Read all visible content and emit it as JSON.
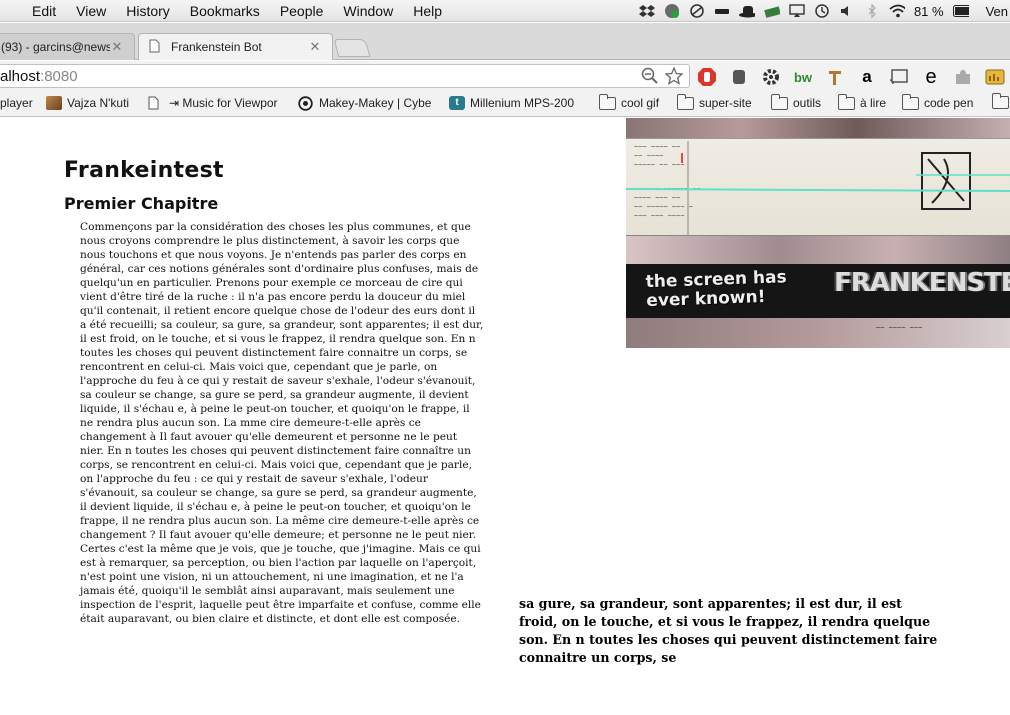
{
  "menubar": {
    "app_items": [
      "Edit",
      "View",
      "History",
      "Bookmarks",
      "People",
      "Window",
      "Help"
    ],
    "battery_percent": "81 %",
    "clock": "Ven"
  },
  "tabs": [
    {
      "title": "(93) - garcins@news",
      "active": false
    },
    {
      "title": "Frankenstein Bot",
      "active": true
    }
  ],
  "address_bar": {
    "host": "alhost",
    "port": ":8080"
  },
  "bookmarks": [
    {
      "label": "player",
      "icon": "none"
    },
    {
      "label": "Vajza N'kuti",
      "icon": "thumbnail-icon"
    },
    {
      "label": "⇥ Music for Viewpor",
      "icon": "page-icon"
    },
    {
      "label": "Makey-Makey | Cybe",
      "icon": "circle-logo-icon"
    },
    {
      "label": "Millenium MPS-200",
      "icon": "tumblr-icon"
    },
    {
      "label": "cool gif",
      "icon": "folder-icon"
    },
    {
      "label": "super-site",
      "icon": "folder-icon"
    },
    {
      "label": "outils",
      "icon": "folder-icon"
    },
    {
      "label": "à lire",
      "icon": "folder-icon"
    },
    {
      "label": "code pen",
      "icon": "folder-icon"
    }
  ],
  "extensions": [
    "stop-icon",
    "puzzle-hand-icon",
    "gear-icon",
    "bw-icon",
    "pin-icon",
    "amazon-icon",
    "cast-icon",
    "e-icon",
    "puzzle-icon",
    "notes-icon"
  ],
  "page": {
    "title": "Frankeintest",
    "chapter": "Premier Chapitre",
    "body": "Commençons par la considération des choses les plus communes, et que nous croyons comprendre le plus distinctement, à savoir les corps que nous touchons et que nous voyons. Je n'entends pas parler des corps en général, car ces notions générales sont d'ordinaire plus confuses, mais de quelqu'un en particulier. Prenons pour exemple ce morceau de cire qui vient d'être tiré de la ruche : il n'a pas encore perdu la douceur du miel qu'il contenait, il retient encore quelque chose de l'odeur des eurs dont il a été recueilli; sa couleur, sa gure, sa grandeur, sont apparentes; il est dur, il est froid, on le touche, et si vous le frappez, il rendra quelque son. En n toutes les choses qui peuvent distinctement faire connaitre un corps, se rencontrent en celui-ci. Mais voici que, cependant que je parle, on l'approche du feu à ce qui y restait de saveur s'exhale, l'odeur s'évanouit, sa couleur se change, sa gure se perd, sa grandeur augmente, il devient liquide, il s'échau e, à peine le peut-on toucher, et quoiqu'on le frappe, il ne rendra plus aucun son. La mme cire demeure-t-elle après ce changement à Il faut avouer qu'elle demeurent et personne ne le peut nier. En n toutes les choses qui peuvent distinctement faire connaître un corps, se rencontrent en celui-ci. Mais voici que, cependant que je parle, on l'approche du feu : ce qui y restait de saveur s'exhale, l'odeur s'évanouit, sa couleur se change, sa gure se perd, sa grandeur augmente, il devient liquide, il s'échau e, à peine le peut-on toucher, et quoiqu'on le frappe, il ne rendra plus aucun son. La même cire demeure-t-elle après ce changement ? Il faut avouer qu'elle demeure; et personne ne le peut nier. Certes c'est la même que je vois, que je touche, que j'imagine. Mais ce qui est à remarquer, sa perception, ou bien l'action par laquelle on l'aperçoit, n'est point une vision, ni un attouchement, ni une imagination, et ne l'a jamais été, quoiqu'il le semblât ainsi auparavant, mais seulement une inspection de l'esprit, laquelle peut être imparfaite et confuse, comme elle était auparavant, ou bien claire et distincte, et dont elle est composée.",
    "quote": "sa gure, sa grandeur, sont apparentes; il est dur, il est froid, on le touche, et si vous le frappez, il rendra quelque son. En n toutes les choses qui peuvent distinctement faire connaitre un corps, se"
  },
  "video_overlay": {
    "caption_left": "the screen has ever known!",
    "caption_right": "FRANKENSTEIN"
  }
}
